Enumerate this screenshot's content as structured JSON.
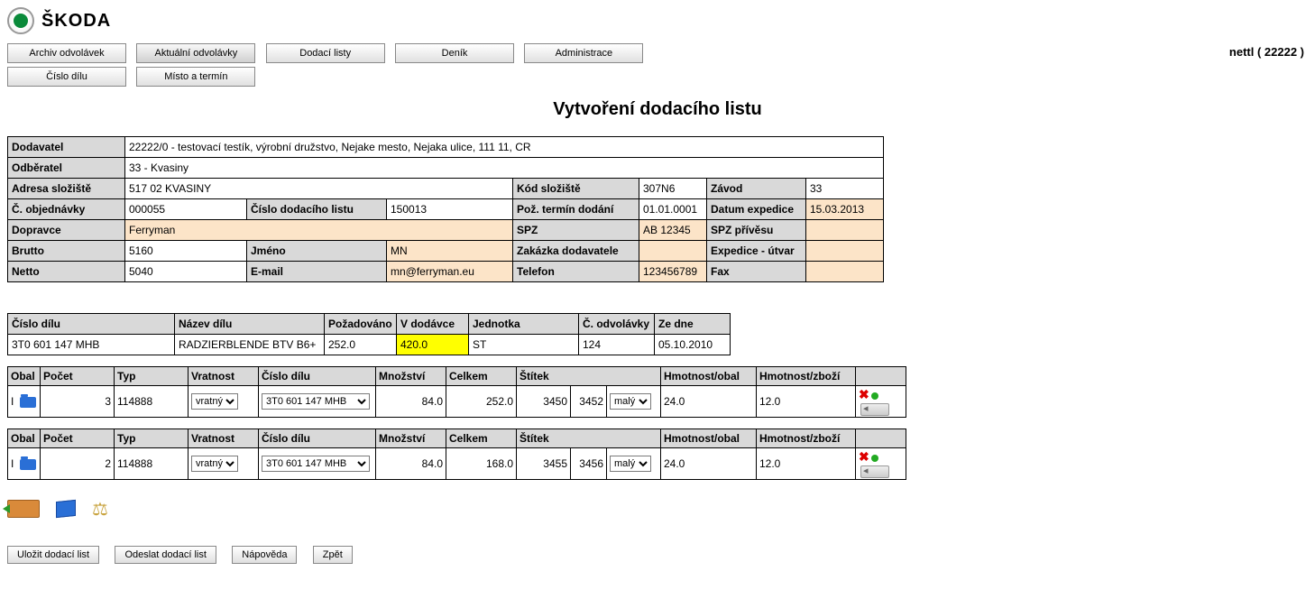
{
  "brand": "ŠKODA",
  "user_label": "nettl ( 22222 )",
  "nav1": [
    "Archiv odvolávek",
    "Aktuální odvolávky",
    "Dodací listy",
    "Deník",
    "Administrace"
  ],
  "nav2": [
    "Číslo dílu",
    "Místo a termín"
  ],
  "page_title": "Vytvoření dodacího listu",
  "hdr": {
    "dodavatel_l": "Dodavatel",
    "dodavatel_v": "22222/0  -  testovací testík, výrobní družstvo,   Nejake mesto,   Nejaka ulice,   111 11,   CR",
    "odberatel_l": "Odběratel",
    "odberatel_v": "33 - Kvasiny",
    "adresa_l": "Adresa složiště",
    "adresa_v": "517 02 KVASINY",
    "kodsloz_l": "Kód složiště",
    "kodsloz_v": "307N6",
    "zavod_l": "Závod",
    "zavod_v": "33",
    "cobj_l": "Č. objednávky",
    "cobj_v": "000055",
    "cdl_l": "Číslo dodacího listu",
    "cdl_v": "150013",
    "pozterm_l": "Pož. termín dodání",
    "pozterm_v": "01.01.0001",
    "datexp_l": "Datum expedice",
    "datexp_v": "15.03.2013",
    "dopravce_l": "Dopravce",
    "dopravce_v": "Ferryman",
    "spz_l": "SPZ",
    "spz_v": "AB 12345",
    "spzp_l": "SPZ přívěsu",
    "spzp_v": "",
    "brutto_l": "Brutto",
    "brutto_v": "5160",
    "jmeno_l": "Jméno",
    "jmeno_v": "MN",
    "zakdod_l": "Zakázka dodavatele",
    "zakdod_v": "",
    "exputv_l": "Expedice - útvar",
    "exputv_v": "",
    "netto_l": "Netto",
    "netto_v": "5040",
    "email_l": "E-mail",
    "email_v": "mn@ferryman.eu",
    "tel_l": "Telefon",
    "tel_v": "123456789",
    "fax_l": "Fax",
    "fax_v": ""
  },
  "part_hdr": [
    "Číslo dílu",
    "Název dílu",
    "Požadováno",
    "V dodávce",
    "Jednotka",
    "Č. odvolávky",
    "Ze dne"
  ],
  "part_row": {
    "cislo": "3T0 601 147   MHB",
    "nazev": "RADZIERBLENDE BTV B6+",
    "pozad": "252.0",
    "vdod": "420.0",
    "jedn": "ST",
    "codv": "124",
    "zedne": "05.10.2010"
  },
  "pack_hdr": [
    "Obal",
    "Počet",
    "Typ",
    "Vratnost",
    "Číslo dílu",
    "Množství",
    "Celkem",
    "Štítek",
    "Hmotnost/obal",
    "Hmotnost/zboží"
  ],
  "pack_rows": [
    {
      "obal": "I",
      "pocet": "3",
      "typ": "114888",
      "vrat": "vratný",
      "cislo": "3T0 601 147 MHB",
      "mnoz": "84.0",
      "celk": "252.0",
      "st_a": "3450",
      "st_b": "3452",
      "st_sel": "malý",
      "hobal": "24.0",
      "hzbozi": "12.0"
    },
    {
      "obal": "I",
      "pocet": "2",
      "typ": "114888",
      "vrat": "vratný",
      "cislo": "3T0 601 147 MHB",
      "mnoz": "84.0",
      "celk": "168.0",
      "st_a": "3455",
      "st_b": "3456",
      "st_sel": "malý",
      "hobal": "24.0",
      "hzbozi": "12.0"
    }
  ],
  "actions": [
    "Uložit dodací list",
    "Odeslat dodací list",
    "Nápověda",
    "Zpět"
  ]
}
